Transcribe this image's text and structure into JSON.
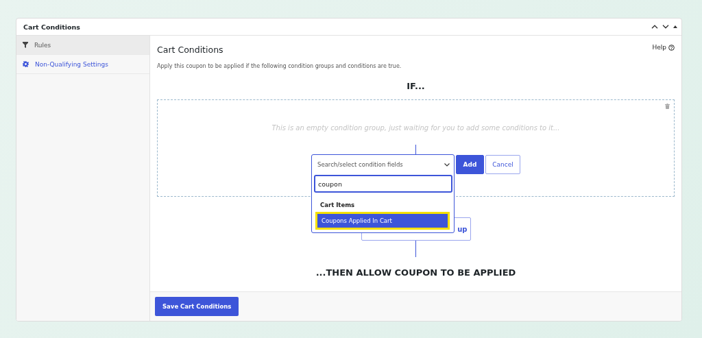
{
  "panel": {
    "title": "Cart Conditions"
  },
  "sidebar": {
    "items": [
      {
        "label": "Rules",
        "kind": "filter",
        "selected": true
      },
      {
        "label": "Non-Qualifying Settings",
        "kind": "gear",
        "selected": false
      }
    ]
  },
  "main": {
    "title": "Cart Conditions",
    "help": "Help",
    "description": "Apply this coupon to be applied if the following condition groups and conditions are true.",
    "if_label": "IF...",
    "group": {
      "empty_text": "This is an empty condition group, just waiting for you to add some conditions to it...",
      "select": {
        "placeholder": "Search/select condition fields",
        "search_value": "coupon",
        "group_label": "Cart Items",
        "options": [
          {
            "label": "Coupons Applied In Cart",
            "selected": true
          }
        ]
      },
      "add_button": "Add",
      "cancel_button": "Cancel"
    },
    "group_button_partial": "up",
    "then_label": "...THEN ALLOW COUPON TO BE APPLIED"
  },
  "footer": {
    "save_button": "Save Cart Conditions"
  }
}
